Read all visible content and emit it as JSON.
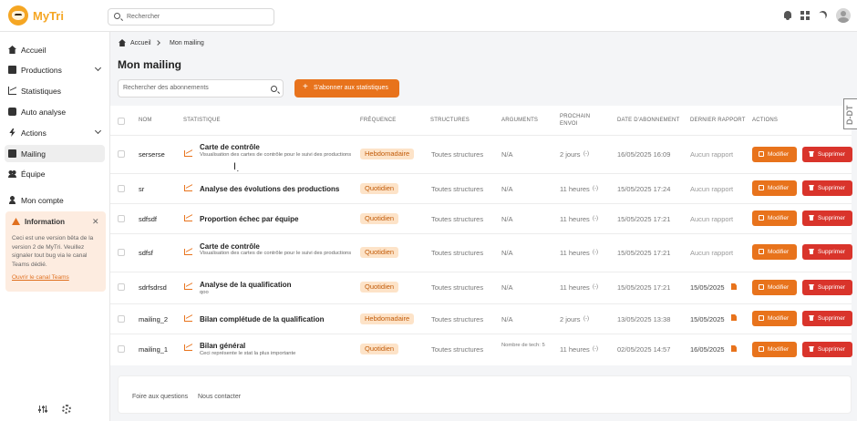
{
  "app": {
    "brand": "MyTri",
    "search_placeholder": "Rechercher"
  },
  "sidebar": {
    "items": [
      {
        "label": "Accueil",
        "icon": "home-icon"
      },
      {
        "label": "Productions",
        "icon": "box-icon"
      },
      {
        "label": "Statistiques",
        "icon": "chart-icon"
      },
      {
        "label": "Auto analyse",
        "icon": "robot-icon"
      },
      {
        "label": "Actions",
        "icon": "bolt-icon"
      },
      {
        "label": "Mailing",
        "icon": "mail-icon"
      },
      {
        "label": "Équipe",
        "icon": "team-icon"
      },
      {
        "label": "Mon compte",
        "icon": "user-icon"
      }
    ],
    "info": {
      "title": "Information",
      "body": "Ceci est une version bêta de la version 2 de MyTri. Veuillez signaler tout bug via le canal Teams dédié.",
      "link": "Ouvrir le canal Teams"
    }
  },
  "breadcrumb": {
    "home": "Accueil",
    "current": "Mon mailing"
  },
  "page": {
    "title": "Mon mailing",
    "search_placeholder": "Rechercher des abonnements",
    "subscribe_label": "S'abonner aux statistiques"
  },
  "table": {
    "headers": {
      "nom": "NOM",
      "statistique": "STATISTIQUE",
      "frequence": "FRÉQUENCE",
      "structures": "STRUCTURES",
      "arguments": "ARGUMENTS",
      "prochain_1": "PROCHAIN",
      "prochain_2": "ENVOI",
      "date": "DATE D'ABONNEMENT",
      "dernier": "DERNIER RAPPORT",
      "actions": "ACTIONS"
    },
    "rows": [
      {
        "nom": "serserse",
        "stat_title": "Carte de contrôle",
        "stat_desc": "Visualisation des cartes de contrôle pour le suivi des productions",
        "frequence": "Hebdomadaire",
        "structures": "Toutes structures",
        "arguments": "N/A",
        "prochain": "2 jours",
        "prochain_suffix": "(-)",
        "date": "16/05/2025 16:09",
        "dernier": "Aucun rapport"
      },
      {
        "nom": "sr",
        "stat_title": "Analyse des évolutions des productions",
        "stat_desc": "",
        "frequence": "Quotidien",
        "structures": "Toutes structures",
        "arguments": "N/A",
        "prochain": "11 heures",
        "prochain_suffix": "(-)",
        "date": "15/05/2025 17:24",
        "dernier": "Aucun rapport"
      },
      {
        "nom": "sdfsdf",
        "stat_title": "Proportion échec par équipe",
        "stat_desc": "",
        "frequence": "Quotidien",
        "structures": "Toutes structures",
        "arguments": "N/A",
        "prochain": "11 heures",
        "prochain_suffix": "(-)",
        "date": "15/05/2025 17:21",
        "dernier": "Aucun rapport"
      },
      {
        "nom": "sdfsf",
        "stat_title": "Carte de contrôle",
        "stat_desc": "Visualisation des cartes de contrôle pour le suivi des productions",
        "frequence": "Quotidien",
        "structures": "Toutes structures",
        "arguments": "N/A",
        "prochain": "11 heures",
        "prochain_suffix": "(-)",
        "date": "15/05/2025 17:21",
        "dernier": "Aucun rapport"
      },
      {
        "nom": "sdrfsdrsd",
        "stat_title": "Analyse de la qualification",
        "stat_desc": "qoo",
        "frequence": "Quotidien",
        "structures": "Toutes structures",
        "arguments": "N/A",
        "prochain": "11 heures",
        "prochain_suffix": "(-)",
        "date": "15/05/2025 17:21",
        "dernier": "15/05/2025"
      },
      {
        "nom": "mailing_2",
        "stat_title": "Bilan complétude de la qualification",
        "stat_desc": "",
        "frequence": "Hebdomadaire",
        "structures": "Toutes structures",
        "arguments": "N/A",
        "prochain": "2 jours",
        "prochain_suffix": "(-)",
        "date": "13/05/2025 13:38",
        "dernier": "15/05/2025"
      },
      {
        "nom": "mailing_1",
        "stat_title": "Bilan général",
        "stat_desc": "Ceci représente le stat la plus importante",
        "frequence": "Quotidien",
        "structures": "Toutes structures",
        "arguments": "Nombre de tech: 5",
        "prochain": "11 heures",
        "prochain_suffix": "(-)",
        "date": "02/05/2025 14:57",
        "dernier": "16/05/2025"
      }
    ],
    "modify_label": "Modifier",
    "delete_label": "Supprimer"
  },
  "footer": {
    "faq": "Foire aux questions",
    "contact": "Nous contacter"
  },
  "side_tab": "D-DT",
  "colors": {
    "accent": "#e8731c",
    "danger": "#d9342b",
    "badge_bg": "#fde3c8",
    "brand": "#f5a623"
  }
}
